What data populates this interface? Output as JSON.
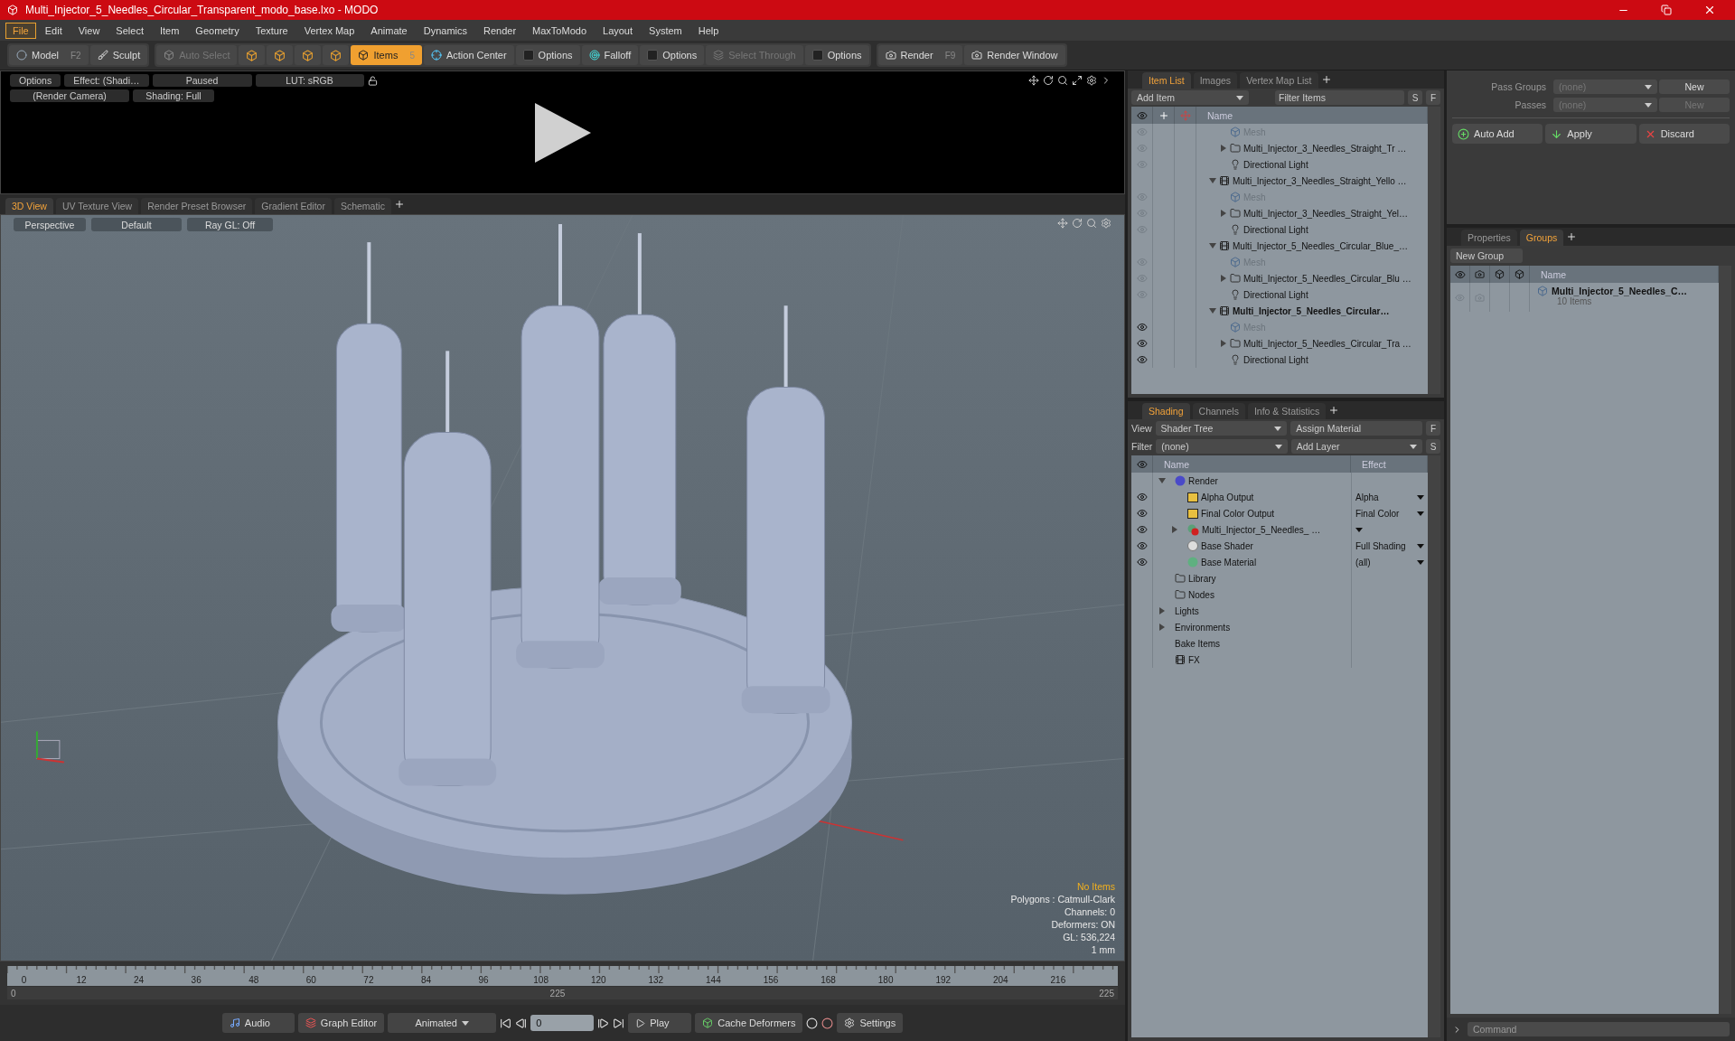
{
  "window": {
    "title": "Multi_Injector_5_Needles_Circular_Transparent_modo_base.lxo - MODO"
  },
  "menu": [
    {
      "label": "File",
      "selected": true
    },
    {
      "label": "Edit",
      "selected": false
    },
    {
      "label": "View",
      "selected": false
    },
    {
      "label": "Select",
      "selected": false
    },
    {
      "label": "Item",
      "selected": false
    },
    {
      "label": "Geometry",
      "selected": false
    },
    {
      "label": "Texture",
      "selected": false
    },
    {
      "label": "Vertex Map",
      "selected": false
    },
    {
      "label": "Animate",
      "selected": false
    },
    {
      "label": "Dynamics",
      "selected": false
    },
    {
      "label": "Render",
      "selected": false
    },
    {
      "label": "MaxToModo",
      "selected": false
    },
    {
      "label": "Layout",
      "selected": false
    },
    {
      "label": "System",
      "selected": false
    },
    {
      "label": "Help",
      "selected": false
    }
  ],
  "toolbar": [
    [
      {
        "kind": "button",
        "label": "Model",
        "shortcut": "F2",
        "selected": false,
        "disabled": false
      },
      {
        "kind": "button",
        "label": "Sculpt",
        "selected": false,
        "disabled": false
      }
    ],
    [
      {
        "kind": "button",
        "label": "Auto Select",
        "selected": false,
        "disabled": true
      },
      {
        "kind": "icon"
      },
      {
        "kind": "icon"
      },
      {
        "kind": "icon"
      },
      {
        "kind": "icon"
      },
      {
        "kind": "button",
        "label": "Items",
        "shortcut": "5",
        "selected": true,
        "disabled": false
      },
      {
        "kind": "button",
        "label": "Action Center",
        "selected": false,
        "disabled": false
      },
      {
        "kind": "check",
        "label": "Options",
        "selected": false,
        "disabled": false
      },
      {
        "kind": "button",
        "label": "Falloff",
        "selected": false,
        "disabled": false
      },
      {
        "kind": "check",
        "label": "Options",
        "selected": false,
        "disabled": false
      },
      {
        "kind": "button",
        "label": "Select Through",
        "selected": false,
        "disabled": true
      },
      {
        "kind": "check",
        "label": "Options",
        "selected": false,
        "disabled": false
      }
    ],
    [
      {
        "kind": "button",
        "label": "Render",
        "shortcut": "F9",
        "selected": false,
        "disabled": false
      },
      {
        "kind": "button",
        "label": "Render Window",
        "selected": false,
        "disabled": false
      }
    ]
  ],
  "preview": {
    "row1": [
      "Options",
      "Effect: (Shadi…",
      "Paused",
      "LUT: sRGB"
    ],
    "row2": [
      "(Render Camera)",
      "Shading: Full"
    ]
  },
  "viewport": {
    "tabs": [
      {
        "label": "3D View",
        "selected": true
      },
      {
        "label": "UV Texture View",
        "selected": false
      },
      {
        "label": "Render Preset Browser",
        "selected": false
      },
      {
        "label": "Gradient Editor",
        "selected": false
      },
      {
        "label": "Schematic",
        "selected": false
      }
    ],
    "buttons": [
      "Perspective",
      "Default",
      "Ray GL: Off"
    ],
    "stats": [
      {
        "text": "No Items",
        "highlight": true
      },
      {
        "text": "Polygons : Catmull-Clark",
        "highlight": false
      },
      {
        "text": "Channels: 0",
        "highlight": false
      },
      {
        "text": "Deformers: ON",
        "highlight": false
      },
      {
        "text": "GL: 536,224",
        "highlight": false
      },
      {
        "text": "1 mm",
        "highlight": false
      }
    ]
  },
  "timeline": {
    "ticks": [
      "0",
      "12",
      "24",
      "36",
      "48",
      "60",
      "72",
      "84",
      "96",
      "108",
      "120",
      "132",
      "144",
      "156",
      "168",
      "180",
      "192",
      "204",
      "216"
    ],
    "range_start": "0",
    "range_middle": "225",
    "range_end": "225"
  },
  "transport": {
    "audio": "Audio",
    "graph_editor": "Graph Editor",
    "mode": "Animated",
    "frame": "0",
    "play": "Play",
    "cache": "Cache Deformers",
    "settings": "Settings"
  },
  "item_list": {
    "tabs": [
      {
        "label": "Item List",
        "selected": true
      },
      {
        "label": "Images",
        "selected": false
      },
      {
        "label": "Vertex Map List",
        "selected": false
      }
    ],
    "add_item": "Add Item",
    "filter": {
      "placeholder": "Filter Items"
    },
    "s_button": "S",
    "f_button": "F",
    "column": "Name",
    "rows": [
      {
        "kind": "mesh",
        "label": "Mesh",
        "visible": false
      },
      {
        "kind": "group",
        "label": "Multi_Injector_3_Needles_Straight_Tr …",
        "visible": false,
        "expanded": false
      },
      {
        "kind": "light",
        "label": "Directional Light",
        "visible": false
      },
      {
        "kind": "scene",
        "label": "Multi_Injector_3_Needles_Straight_Yello …",
        "selected": false,
        "expanded": true,
        "children": [
          {
            "kind": "mesh",
            "label": "Mesh",
            "visible": false
          },
          {
            "kind": "group",
            "label": "Multi_Injector_3_Needles_Straight_Yel…",
            "visible": false,
            "expanded": false
          },
          {
            "kind": "light",
            "label": "Directional Light",
            "visible": false
          }
        ]
      },
      {
        "kind": "scene",
        "label": "Multi_Injector_5_Needles_Circular_Blue_…",
        "selected": false,
        "expanded": true,
        "children": [
          {
            "kind": "mesh",
            "label": "Mesh",
            "visible": false
          },
          {
            "kind": "group",
            "label": "Multi_Injector_5_Needles_Circular_Blu …",
            "visible": false,
            "expanded": false
          },
          {
            "kind": "light",
            "label": "Directional Light",
            "visible": false
          }
        ]
      },
      {
        "kind": "scene",
        "label": "Multi_Injector_5_Needles_Circular…",
        "selected": true,
        "expanded": true,
        "children": [
          {
            "kind": "mesh",
            "label": "Mesh",
            "visible": true
          },
          {
            "kind": "group",
            "label": "Multi_Injector_5_Needles_Circular_Tra …",
            "visible": true,
            "expanded": false
          },
          {
            "kind": "light",
            "label": "Directional Light",
            "visible": true
          }
        ]
      }
    ]
  },
  "shading": {
    "tabs": [
      {
        "label": "Shading",
        "selected": true
      },
      {
        "label": "Channels",
        "selected": false
      },
      {
        "label": "Info & Statistics",
        "selected": false
      }
    ],
    "view_label": "View",
    "view": "Shader Tree",
    "assign": "Assign Material",
    "f_button": "F",
    "filter_label": "Filter",
    "filter": "(none)",
    "add_layer": "Add Layer",
    "s_button": "S",
    "columns": [
      "Name",
      "Effect"
    ],
    "rows": [
      {
        "kind": "render",
        "label": "Render",
        "expanded": true,
        "children": [
          {
            "kind": "output",
            "label": "Alpha Output",
            "effect": "Alpha",
            "visible": true
          },
          {
            "kind": "output",
            "label": "Final Color Output",
            "effect": "Final Color",
            "visible": true
          },
          {
            "kind": "material_group",
            "label": "Multi_Injector_5_Needles_ …",
            "visible": true,
            "expanded": false
          },
          {
            "kind": "shader",
            "label": "Base Shader",
            "effect": "Full Shading",
            "visible": true
          },
          {
            "kind": "material",
            "label": "Base Material",
            "effect": "(all)",
            "visible": true
          }
        ]
      },
      {
        "kind": "folder",
        "label": "Library"
      },
      {
        "kind": "folder",
        "label": "Nodes"
      },
      {
        "kind": "plain",
        "label": "Lights",
        "expanded": false
      },
      {
        "kind": "plain",
        "label": "Environments",
        "expanded": false
      },
      {
        "kind": "plain",
        "label": "Bake Items"
      },
      {
        "kind": "clapper",
        "label": "FX"
      }
    ]
  },
  "passes": [
    {
      "label": "Pass Groups",
      "value": "(none)",
      "button": "New",
      "disabled": false
    },
    {
      "label": "Passes",
      "value": "(none)",
      "button": "New",
      "disabled": true
    }
  ],
  "pass_actions": [
    "Auto Add",
    "Apply",
    "Discard"
  ],
  "groups": {
    "tabs": [
      {
        "label": "Properties",
        "selected": false
      },
      {
        "label": "Groups",
        "selected": true
      }
    ],
    "new_group": "New Group",
    "column": "Name",
    "rows": [
      {
        "name": "Multi_Injector_5_Needles_C…",
        "count": "10 Items"
      }
    ]
  },
  "command": {
    "placeholder": "Command"
  }
}
